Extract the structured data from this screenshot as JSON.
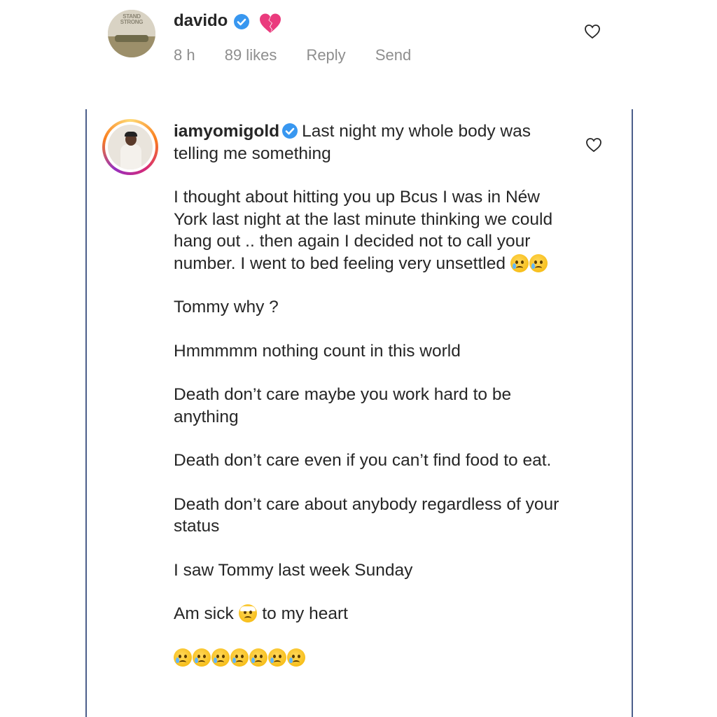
{
  "top_comment": {
    "username": "davido",
    "time": "8 h",
    "likes": "89 likes",
    "reply_label": "Reply",
    "send_label": "Send",
    "avatar_text": "STAND STRONG",
    "status_emoji": "broken-heart"
  },
  "reply_comment": {
    "username": "iamyomigold",
    "first_line": "Last night my whole body was telling me something",
    "paragraphs": [
      "I thought about hitting you up Bcus I was in Néw York last night at the last minute thinking we could hang out .. then again I decided not to call your number. I went to bed feeling very unsettled",
      "Tommy why ?",
      "Hmmmmm nothing count in this world",
      "Death don’t care maybe you work hard to be anything",
      "Death don’t care even if you can’t find food to eat.",
      "Death don’t care about anybody regardless of your status",
      "I saw Tommy last week Sunday",
      "Am sick",
      "to my heart"
    ],
    "final_emoji_count": 7
  },
  "colors": {
    "verified": "#3897f0",
    "text": "#262626",
    "meta": "#8e8e8e",
    "border": "#4b5e8a"
  },
  "icons": {
    "like": "heart-outline-icon",
    "verified": "verified-badge-icon",
    "crying": "crying-face-icon",
    "bandage": "face-with-head-bandage-icon"
  }
}
